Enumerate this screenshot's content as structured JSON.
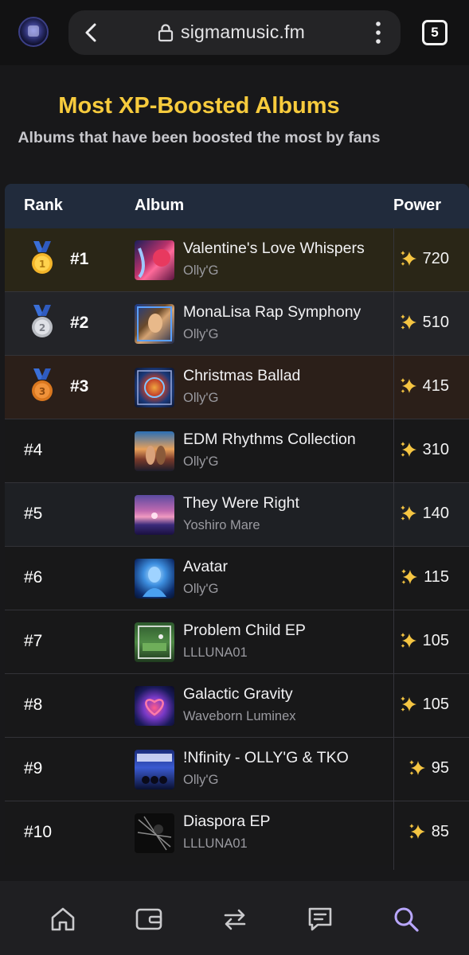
{
  "browser": {
    "url": "sigmamusic.fm",
    "tab_count": "5"
  },
  "page": {
    "title": "Most XP-Boosted Albums",
    "subtitle": "Albums that have been boosted the most by fans"
  },
  "table": {
    "headers": {
      "rank": "Rank",
      "album": "Album",
      "power": "Power"
    },
    "rows": [
      {
        "rank": "#1",
        "title": "Valentine's Love Whispers",
        "artist": "Olly'G",
        "power": "720",
        "medal": "gold"
      },
      {
        "rank": "#2",
        "title": "MonaLisa Rap Symphony",
        "artist": "Olly'G",
        "power": "510",
        "medal": "silver"
      },
      {
        "rank": "#3",
        "title": "Christmas Ballad",
        "artist": "Olly'G",
        "power": "415",
        "medal": "bronze"
      },
      {
        "rank": "#4",
        "title": "EDM Rhythms Collection",
        "artist": "Olly'G",
        "power": "310",
        "medal": ""
      },
      {
        "rank": "#5",
        "title": "They Were Right",
        "artist": "Yoshiro Mare",
        "power": "140",
        "medal": ""
      },
      {
        "rank": "#6",
        "title": "Avatar",
        "artist": "Olly'G",
        "power": "115",
        "medal": ""
      },
      {
        "rank": "#7",
        "title": "Problem Child EP",
        "artist": "LLLUNA01",
        "power": "105",
        "medal": ""
      },
      {
        "rank": "#8",
        "title": "Galactic Gravity",
        "artist": "Waveborn Luminex",
        "power": "105",
        "medal": ""
      },
      {
        "rank": "#9",
        "title": "!Nfinity - OLLY'G & TKO",
        "artist": "Olly'G",
        "power": "95",
        "medal": ""
      },
      {
        "rank": "#10",
        "title": "Diaspora EP",
        "artist": "LLLUNA01",
        "power": "85",
        "medal": ""
      }
    ]
  },
  "icons": {
    "power": "sparkle-icon",
    "nav": [
      "home-icon",
      "wallet-icon",
      "swap-icon",
      "chat-icon",
      "search-icon"
    ]
  },
  "colors": {
    "title": "#f7cb3d",
    "sparkle": "#f5c542",
    "active_nav": "#b9a7ff",
    "gold_row": "#2a2617",
    "bronze_row": "#2b1f19"
  }
}
